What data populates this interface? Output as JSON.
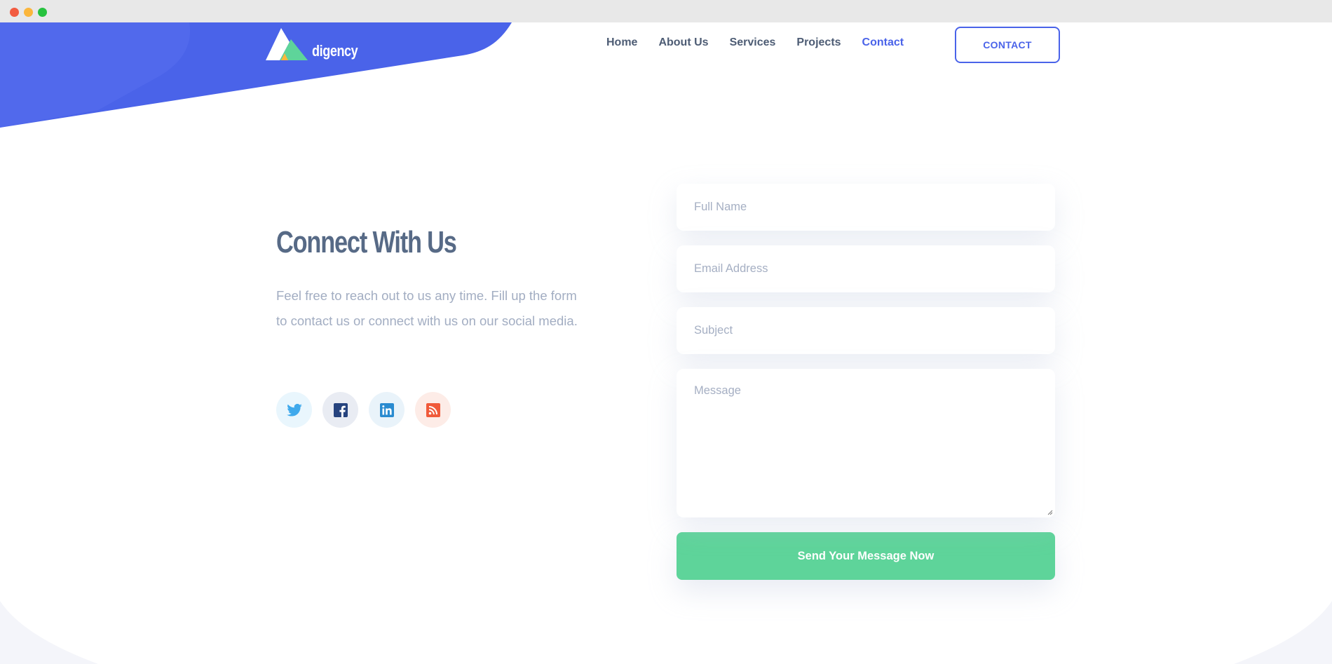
{
  "window": {
    "controls": [
      "close",
      "minimize",
      "maximize"
    ]
  },
  "brand": {
    "name": "digency",
    "logo_icon": "mountain-triangles-logo"
  },
  "nav": {
    "items": [
      {
        "label": "Home",
        "active": false
      },
      {
        "label": "About Us",
        "active": false
      },
      {
        "label": "Services",
        "active": false
      },
      {
        "label": "Projects",
        "active": false
      },
      {
        "label": "Contact",
        "active": true
      }
    ],
    "cta_label": "CONTACT"
  },
  "contact": {
    "heading": "Connect With Us",
    "description": "Feel free to reach out to us any time. Fill up the form to contact us or connect with us on our social media.",
    "socials": [
      {
        "name": "twitter",
        "icon": "twitter-icon",
        "color": "#3fa9ec"
      },
      {
        "name": "facebook",
        "icon": "facebook-icon",
        "color": "#26437e"
      },
      {
        "name": "linkedin",
        "icon": "linkedin-icon",
        "color": "#2a8bd0"
      },
      {
        "name": "rss",
        "icon": "rss-icon",
        "color": "#f05a3a"
      }
    ]
  },
  "form": {
    "full_name": {
      "placeholder": "Full Name",
      "value": ""
    },
    "email": {
      "placeholder": "Email Address",
      "value": ""
    },
    "subject": {
      "placeholder": "Subject",
      "value": ""
    },
    "message": {
      "placeholder": "Message",
      "value": ""
    },
    "submit_label": "Send Your Message Now"
  },
  "colors": {
    "primary": "#4a63e9",
    "accent_green": "#5ed49a",
    "heading": "#576a86",
    "nav_text": "#4d5c74",
    "muted_text": "#a2adc2"
  }
}
